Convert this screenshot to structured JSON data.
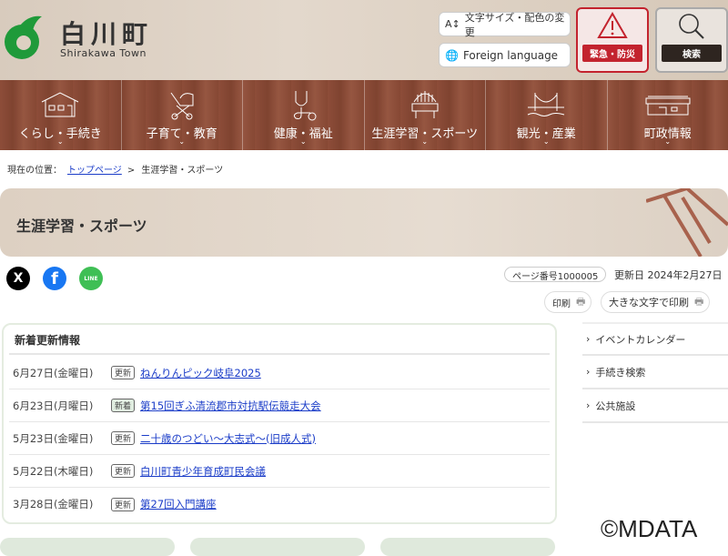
{
  "header": {
    "logo_jp": "白川町",
    "logo_en": "Shirakawa Town",
    "text_size_label": "文字サイズ・配色の変更",
    "foreign_label": "Foreign language",
    "emergency_label": "緊急・防災",
    "search_label": "検索"
  },
  "nav": [
    {
      "label": "くらし・手続き",
      "icon": "house-icon"
    },
    {
      "label": "子育て・教育",
      "icon": "stroller-icon"
    },
    {
      "label": "健康・福祉",
      "icon": "stethoscope-icon"
    },
    {
      "label": "生涯学習・スポーツ",
      "icon": "building-icon"
    },
    {
      "label": "観光・産業",
      "icon": "bridge-icon"
    },
    {
      "label": "町政情報",
      "icon": "townhall-icon"
    }
  ],
  "breadcrumb": {
    "prefix": "現在の位置：",
    "home": "トップページ",
    "sep": ">",
    "current": "生涯学習・スポーツ"
  },
  "page_title": "生涯学習・スポーツ",
  "meta": {
    "page_no": "ページ番号1000005",
    "updated": "更新日 2024年2月27日",
    "print": "印刷",
    "print_large": "大きな文字で印刷"
  },
  "social": {
    "x": "X",
    "facebook": "f",
    "line": "LINE"
  },
  "news": {
    "title": "新着更新情報",
    "items": [
      {
        "date": "6月27日(金曜日)",
        "badge": "更新",
        "title": "ねんりんピック岐阜2025"
      },
      {
        "date": "6月23日(月曜日)",
        "badge": "新着",
        "title": "第15回ぎふ清流郡市対抗駅伝競走大会"
      },
      {
        "date": "5月23日(金曜日)",
        "badge": "更新",
        "title": "二十歳のつどい～大志式～(旧成人式)"
      },
      {
        "date": "5月22日(木曜日)",
        "badge": "更新",
        "title": "白川町青少年育成町民会議"
      },
      {
        "date": "3月28日(金曜日)",
        "badge": "更新",
        "title": "第27回入門講座"
      }
    ]
  },
  "side": [
    "イベントカレンダー",
    "手続き検索",
    "公共施設"
  ],
  "watermark": "©MDATA",
  "colors": {
    "nav": "#8a4a36",
    "emergency": "#c3232e",
    "link": "#1a3cc8"
  }
}
